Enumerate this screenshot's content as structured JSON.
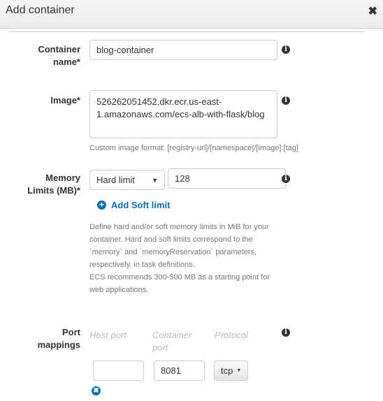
{
  "dialog": {
    "title": "Add container",
    "close_icon": "close-icon"
  },
  "container_name": {
    "label_1": "Container",
    "label_2": "name*",
    "value": "blog-container"
  },
  "image": {
    "label": "Image*",
    "value_1": "526262051452.dkr.ecr.us-east-",
    "value_2": "1.amazonaws.com/ecs-alb-with-flask/blog",
    "help": "Custom image format: [registry-url]/[namespace]/[image]:[tag]"
  },
  "memory": {
    "label_1": "Memory",
    "label_2": "Limits (MB)*",
    "limit_type": "Hard limit",
    "value": "128",
    "add_soft_limit": "Add Soft limit",
    "help": [
      "Define hard and/or soft memory limits in MiB for your",
      "container. Hard and soft limits correspond to the",
      "`memory` and `memoryReservation` parameters,",
      "respectively, in task definitions.",
      "ECS recommends 300-500 MB as a starting point for",
      "web applications."
    ]
  },
  "ports": {
    "label_1": "Port",
    "label_2": "mappings",
    "host_port_header": "Host port",
    "container_port_header_1": "Container",
    "container_port_header_2": "port",
    "protocol_header": "Protocol",
    "host_port": "",
    "container_port": "8081",
    "protocol": "tcp"
  },
  "colors": {
    "accent": "#0a6ebd"
  }
}
